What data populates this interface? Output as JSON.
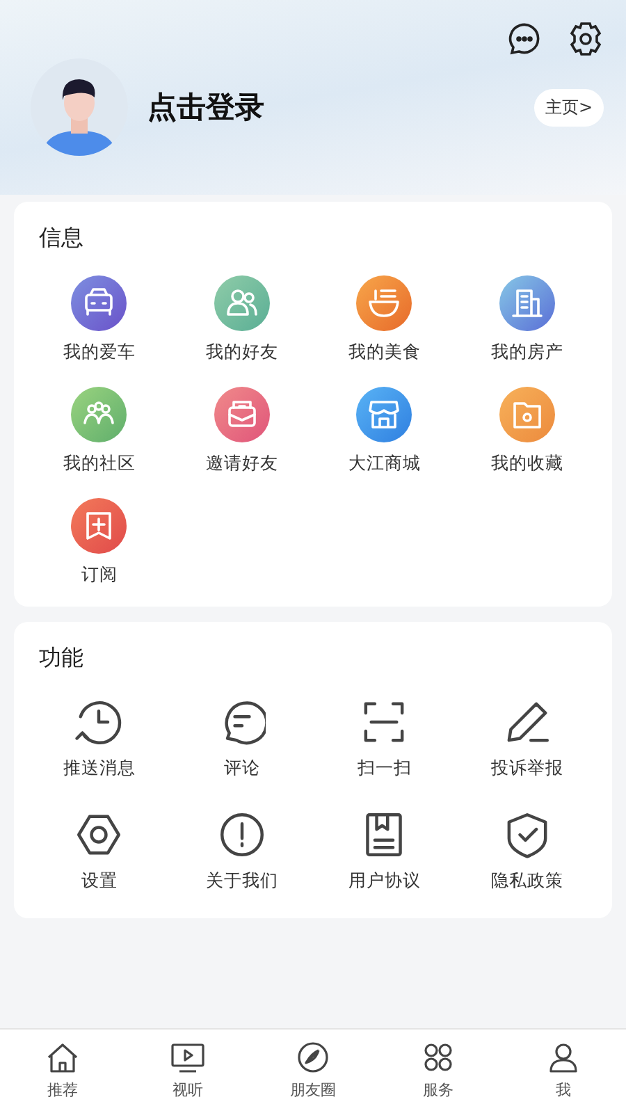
{
  "header": {
    "login_label": "点击登录",
    "homepage_button": "主页>"
  },
  "info_section": {
    "title": "信息",
    "items": [
      {
        "label": "我的爱车"
      },
      {
        "label": "我的好友"
      },
      {
        "label": "我的美食"
      },
      {
        "label": "我的房产"
      },
      {
        "label": "我的社区"
      },
      {
        "label": "邀请好友"
      },
      {
        "label": "大江商城"
      },
      {
        "label": "我的收藏"
      },
      {
        "label": "订阅"
      }
    ]
  },
  "function_section": {
    "title": "功能",
    "items": [
      {
        "label": "推送消息"
      },
      {
        "label": "评论"
      },
      {
        "label": "扫一扫"
      },
      {
        "label": "投诉举报"
      },
      {
        "label": "设置"
      },
      {
        "label": "关于我们"
      },
      {
        "label": "用户协议"
      },
      {
        "label": "隐私政策"
      }
    ]
  },
  "tab_bar": [
    {
      "label": "推荐",
      "selected": false
    },
    {
      "label": "视听",
      "selected": false
    },
    {
      "label": "朋友圈",
      "selected": false
    },
    {
      "label": "服务",
      "selected": false
    },
    {
      "label": "我",
      "selected": false
    }
  ]
}
